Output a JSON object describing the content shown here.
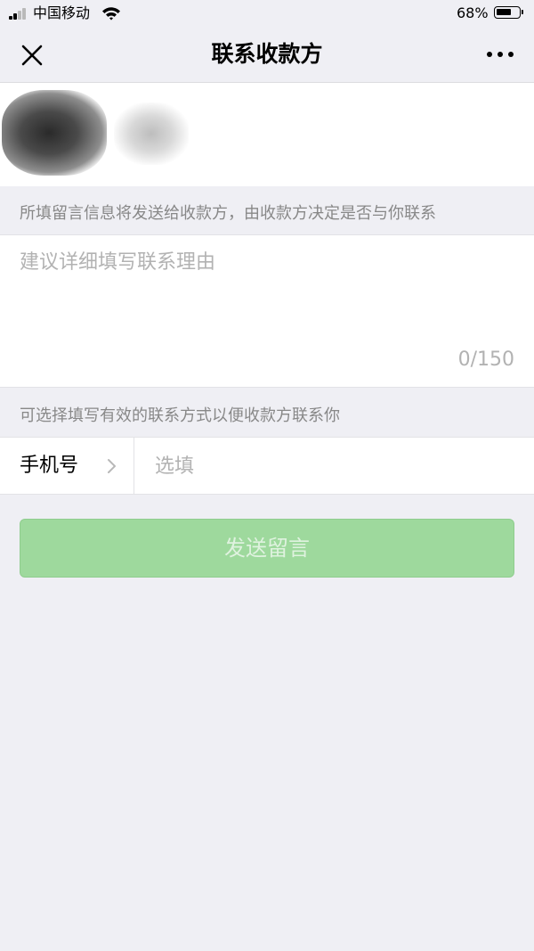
{
  "status_bar": {
    "carrier": "中国移动",
    "battery_percent": "68%",
    "battery_level": 0.68
  },
  "nav": {
    "title": "联系收款方",
    "close_icon": "close-icon",
    "more_icon": "more-icon"
  },
  "notes": {
    "message_note": "所填留言信息将发送给收款方，由收款方决定是否与你联系",
    "contact_note": "可选择填写有效的联系方式以便收款方联系你"
  },
  "message": {
    "placeholder": "建议详细填写联系理由",
    "value": "",
    "counter": "0/150"
  },
  "phone": {
    "label": "手机号",
    "placeholder": "选填",
    "value": ""
  },
  "send_button": {
    "label": "发送留言"
  },
  "colors": {
    "background": "#efeff4",
    "send_button": "#9ed99d",
    "send_button_text": "#dff2df",
    "note_text": "#888888",
    "placeholder": "#b2b2b2"
  }
}
